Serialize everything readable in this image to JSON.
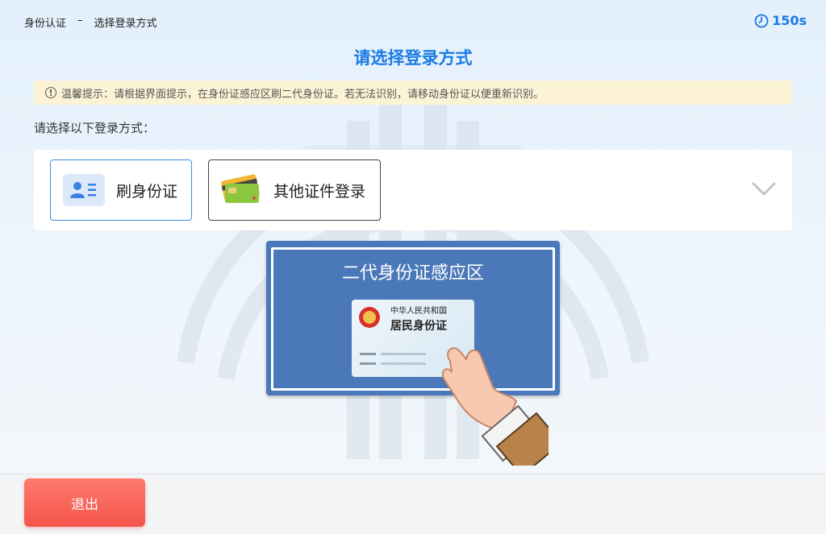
{
  "header": {
    "breadcrumb": [
      "身份认证",
      "–",
      "选择登录方式"
    ],
    "timer": "150s",
    "title": "请选择登录方式"
  },
  "notice": {
    "icon": "exclamation-circle-icon",
    "text": "温馨提示：请根据界面提示，在身份证感应区刷二代身份证。若无法识别，请移动身份证以便重新识别。"
  },
  "choose_label": "请选择以下登录方式：",
  "options": [
    {
      "label": "刷身份证",
      "icon": "id-card-user-icon",
      "selected": true
    },
    {
      "label": "其他证件登录",
      "icon": "bank-card-icon",
      "selected": false
    }
  ],
  "reader": {
    "title": "二代身份证感应区",
    "card": {
      "line1": "中华人民共和国",
      "line2": "居民身份证"
    }
  },
  "footer": {
    "exit_label": "退出"
  },
  "colors": {
    "accent": "#1a7be6",
    "notice_bg": "#fcf3d6",
    "reader_blue": "#4a78b8",
    "exit_red": "#f3544a"
  }
}
